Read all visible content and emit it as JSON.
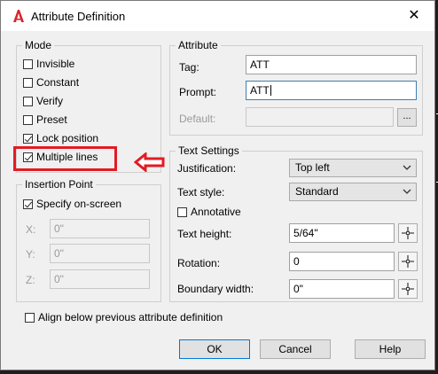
{
  "window": {
    "title": "Attribute Definition",
    "close_glyph": "✕"
  },
  "mode": {
    "title": "Mode",
    "items": [
      {
        "label": "Invisible",
        "checked": false
      },
      {
        "label": "Constant",
        "checked": false
      },
      {
        "label": "Verify",
        "checked": false
      },
      {
        "label": "Preset",
        "checked": false
      },
      {
        "label": "Lock position",
        "checked": true
      },
      {
        "label": "Multiple lines",
        "checked": true
      }
    ]
  },
  "attribute": {
    "title": "Attribute",
    "tag_label": "Tag:",
    "tag_value": "ATT",
    "prompt_label": "Prompt:",
    "prompt_value": "ATT",
    "default_label": "Default:",
    "default_value": "",
    "default_button": "..."
  },
  "insertion": {
    "title": "Insertion Point",
    "specify_label": "Specify on-screen",
    "specify_checked": true,
    "x_label": "X:",
    "x_value": "0\"",
    "y_label": "Y:",
    "y_value": "0\"",
    "z_label": "Z:",
    "z_value": "0\""
  },
  "text_settings": {
    "title": "Text Settings",
    "justification_label": "Justification:",
    "justification_value": "Top left",
    "text_style_label": "Text style:",
    "text_style_value": "Standard",
    "annotative_label": "Annotative",
    "annotative_checked": false,
    "text_height_label": "Text height:",
    "text_height_value": "5/64\"",
    "rotation_label": "Rotation:",
    "rotation_value": "0",
    "boundary_width_label": "Boundary width:",
    "boundary_width_value": "0\""
  },
  "align_label": "Align below previous attribute definition",
  "buttons": {
    "ok": "OK",
    "cancel": "Cancel",
    "help": "Help"
  },
  "colors": {
    "highlight": "#e31b23",
    "logo": "#d8232a",
    "focus_border": "#3c7fb1"
  },
  "icons": {
    "pick_point": "crosshair-pick-icon",
    "dropdown": "chevron-down-icon"
  }
}
